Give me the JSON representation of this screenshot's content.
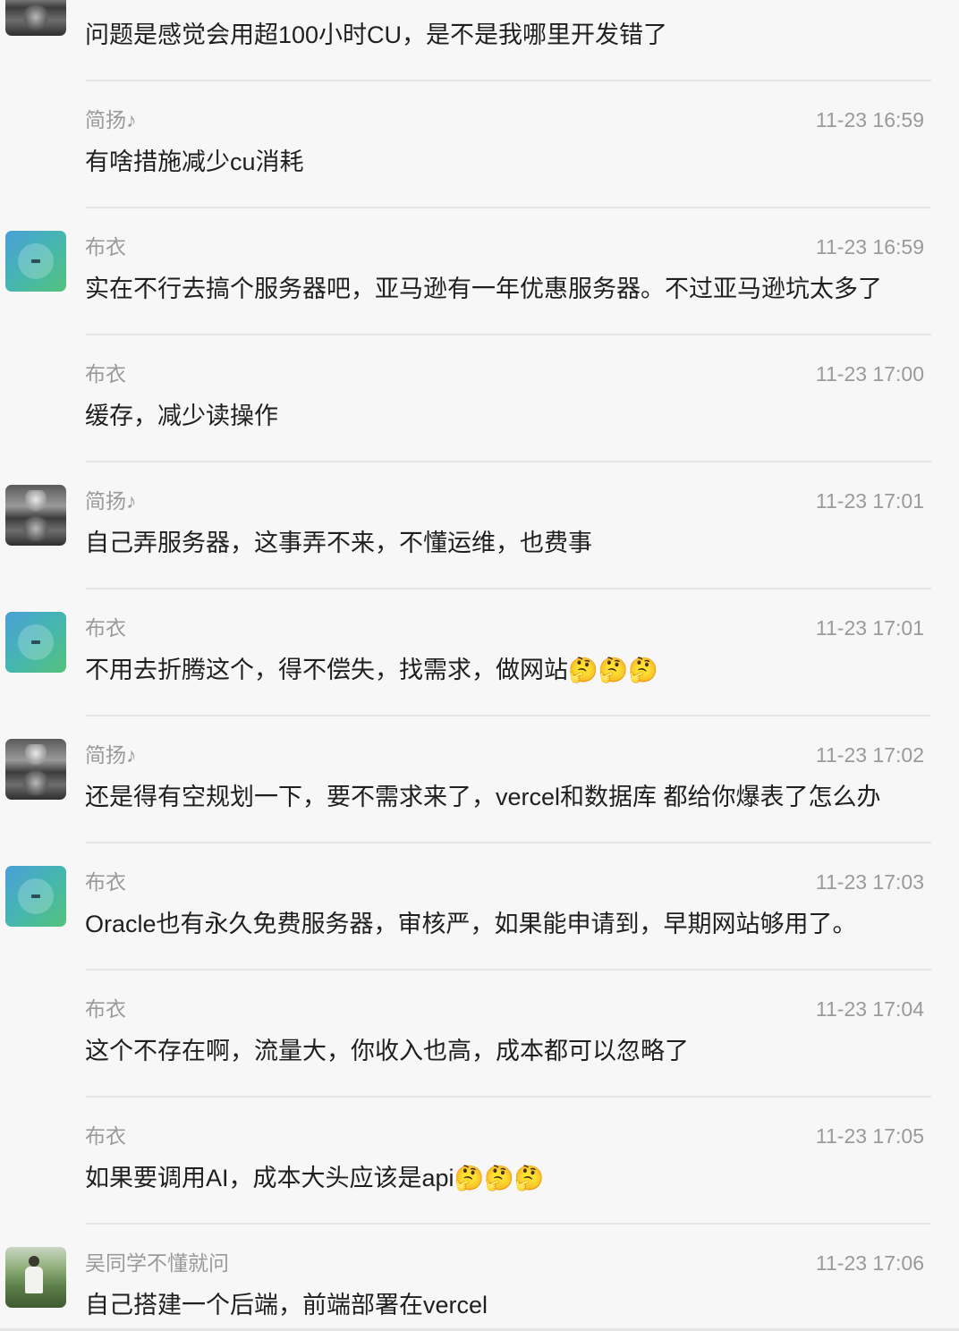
{
  "messages": [
    {
      "avatar": "tiger",
      "name": "",
      "time": "",
      "text": "问题是感觉会用超100小时CU，是不是我哪里开发错了"
    },
    {
      "avatar": "",
      "name": "简扬♪",
      "time": "11-23 16:59",
      "text": "有啥措施减少cu消耗"
    },
    {
      "avatar": "gradient",
      "name": "布衣",
      "time": "11-23 16:59",
      "text": "实在不行去搞个服务器吧，亚马逊有一年优惠服务器。不过亚马逊坑太多了"
    },
    {
      "avatar": "",
      "name": "布衣",
      "time": "11-23 17:00",
      "text": "缓存，减少读操作"
    },
    {
      "avatar": "tiger",
      "name": "简扬♪",
      "time": "11-23 17:01",
      "text": "自己弄服务器，这事弄不来，不懂运维，也费事"
    },
    {
      "avatar": "gradient",
      "name": "布衣",
      "time": "11-23 17:01",
      "text": "不用去折腾这个，得不偿失，找需求，做网站🤔🤔🤔"
    },
    {
      "avatar": "tiger",
      "name": "简扬♪",
      "time": "11-23 17:02",
      "text": "还是得有空规划一下，要不需求来了，vercel和数据库 都给你爆表了怎么办"
    },
    {
      "avatar": "gradient",
      "name": "布衣",
      "time": "11-23 17:03",
      "text": "Oracle也有永久免费服务器，审核严，如果能申请到，早期网站够用了。"
    },
    {
      "avatar": "",
      "name": "布衣",
      "time": "11-23 17:04",
      "text": "这个不存在啊，流量大，你收入也高，成本都可以忽略了"
    },
    {
      "avatar": "",
      "name": "布衣",
      "time": "11-23 17:05",
      "text": "如果要调用AI，成本大头应该是api🤔🤔🤔"
    },
    {
      "avatar": "outdoor",
      "name": "吴同学不懂就问",
      "time": "11-23 17:06",
      "text": "自己搭建一个后端，前端部署在vercel"
    }
  ]
}
